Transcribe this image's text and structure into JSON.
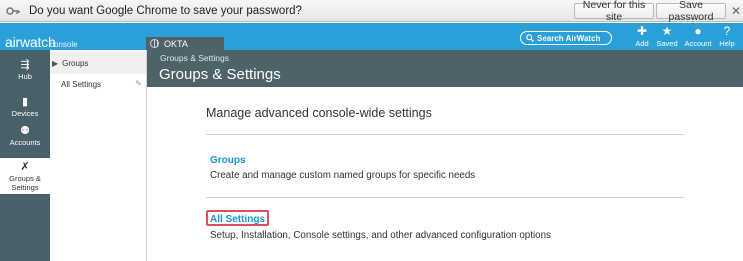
{
  "password_bar": {
    "message": "Do you want Google Chrome to save your password?",
    "never_label": "Never for this site",
    "save_label": "Save password",
    "close_glyph": "✕"
  },
  "header": {
    "logo": "airwatch",
    "logo_sub": "console",
    "org_name": "OKTA",
    "search_label": "Search AirWatch",
    "actions": [
      {
        "icon": "plus-icon",
        "glyph": "✚",
        "label": "Add"
      },
      {
        "icon": "star-icon",
        "glyph": "★",
        "label": "Saved"
      },
      {
        "icon": "person-icon",
        "glyph": "●",
        "label": "Account"
      },
      {
        "icon": "help-icon",
        "glyph": "?",
        "label": "Help"
      }
    ],
    "accent": "#2a9fd8"
  },
  "rail": {
    "items": [
      {
        "icon": "hub-icon",
        "glyph": "⇶",
        "label": "Hub"
      },
      {
        "icon": "devices-icon",
        "glyph": "▮",
        "label": "Devices"
      },
      {
        "icon": "accounts-icon",
        "glyph": "⚉",
        "label": "Accounts"
      },
      {
        "icon": "tools-icon",
        "glyph": "✗",
        "label": "Groups &",
        "label2": "Settings"
      }
    ]
  },
  "subnav": {
    "items": [
      {
        "label": "Groups"
      },
      {
        "label": "All Settings"
      }
    ]
  },
  "page": {
    "breadcrumb": "Groups & Settings",
    "title": "Groups & Settings"
  },
  "main": {
    "heading": "Manage advanced console-wide settings",
    "sections": [
      {
        "link": "Groups",
        "description": "Create and manage custom named groups for specific needs"
      },
      {
        "link": "All Settings",
        "description": "Setup, Installation, Console settings, and other advanced configuration options"
      }
    ],
    "link_color": "#1a93cf",
    "highlight_color": "#e0505a"
  }
}
